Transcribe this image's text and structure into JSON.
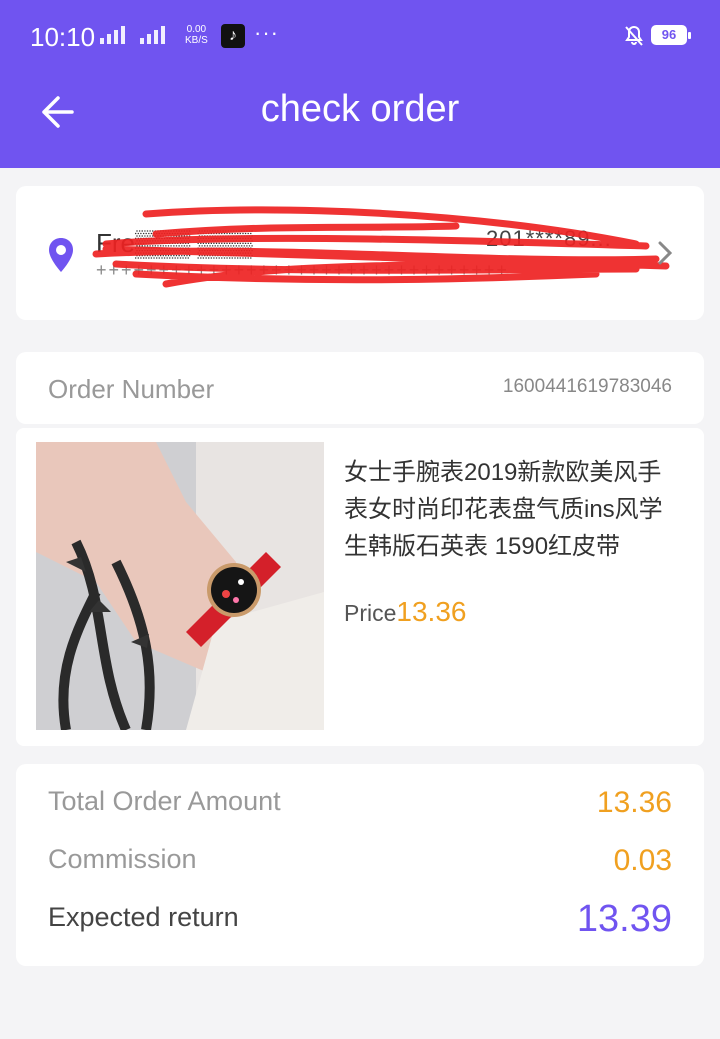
{
  "status_bar": {
    "time": "10:10",
    "net_speed_top": "0.00",
    "net_speed_bottom": "KB/S",
    "network_type": "4G",
    "more": "···",
    "battery": "96"
  },
  "header": {
    "title": "check order",
    "back_icon": "arrow-left-icon",
    "background": "#7054f0"
  },
  "address": {
    "name": "Fre▒▒▒ ▒▒▒",
    "phone": "201****89...",
    "line": "+++++++++++++++++++++++++++++++++",
    "pin_icon": "location-pin-icon",
    "chevron_icon": "chevron-right-icon",
    "redacted": true
  },
  "order": {
    "number_label": "Order Number",
    "number_value": "1600441619783046"
  },
  "product": {
    "name": "女士手腕表2019新款欧美风手表女时尚印花表盘气质ins风学生韩版石英表 1590红皮带",
    "price_label": "Price",
    "price_value": "13.36"
  },
  "totals": {
    "total_label": "Total Order Amount",
    "total_value": "13.36",
    "commission_label": "Commission",
    "commission_value": "0.03",
    "return_label": "Expected return",
    "return_value": "13.39"
  },
  "colors": {
    "accent": "#7054f0",
    "price": "#f0a020",
    "background": "#f4f4f6"
  }
}
